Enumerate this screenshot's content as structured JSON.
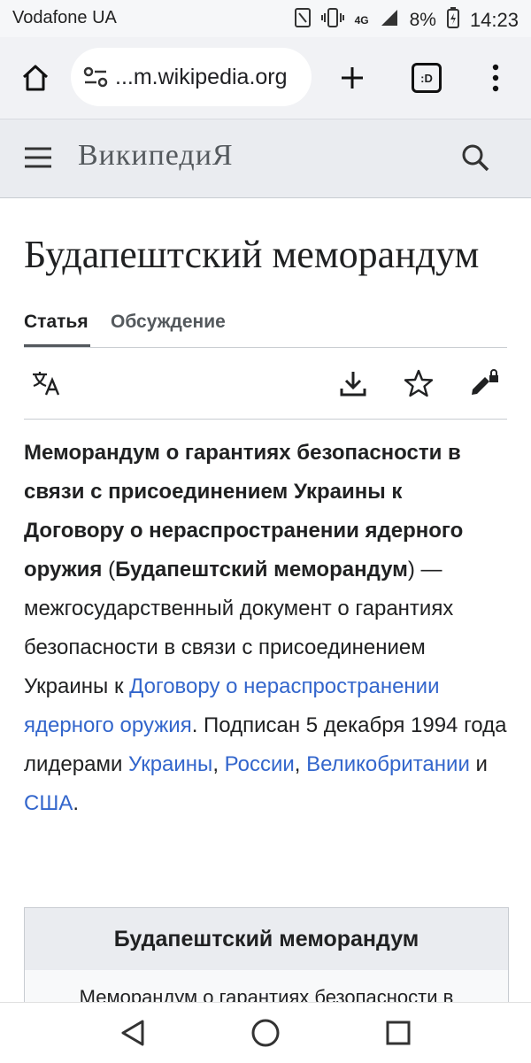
{
  "status_bar": {
    "carrier": "Vodafone UA",
    "network": "4G",
    "battery": "8%",
    "time": "14:23"
  },
  "browser": {
    "url": "...m.wikipedia.org",
    "tab_count": ":D"
  },
  "wiki_header": {
    "logo_text": "ВикипедиЯ"
  },
  "article": {
    "title": "Будапештский меморандум",
    "tabs": [
      {
        "label": "Статья",
        "active": true
      },
      {
        "label": "Обсуждение",
        "active": false
      }
    ],
    "lead": {
      "bold1": "Меморандум о гарантиях безопасности в связи с присоединением Украины к Договору о нераспространении ядерного оружия",
      "t1": " (",
      "bold2": "Будапештский меморандум",
      "t2": ") — межгосударственный документ о гарантиях безопасности в связи с присоединением Украины к ",
      "link1": "Договору о нераспространении ядерного оружия",
      "t3": ". Подписан 5 декабря 1994 года лидерами ",
      "link2": "Украины",
      "t4": ", ",
      "link3": "России",
      "t5": ", ",
      "link4": "Великобритании",
      "t6": " и ",
      "link5": "США",
      "t7": "."
    },
    "infobox": {
      "title": "Будапештский меморандум",
      "first_line": "Меморандум о гарантиях безопасности в"
    }
  }
}
